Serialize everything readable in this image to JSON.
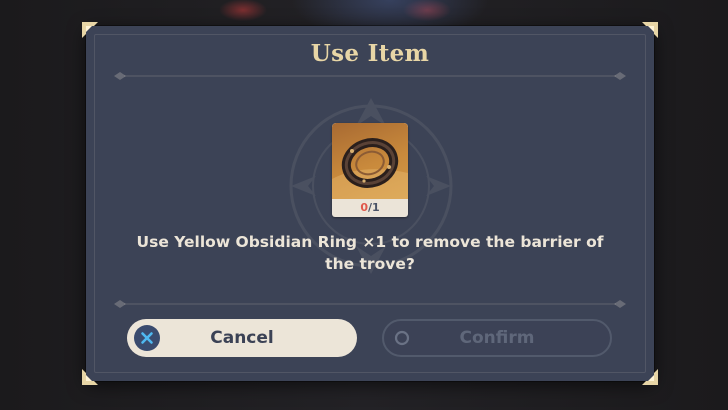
{
  "dialog": {
    "title": "Use Item",
    "item": {
      "name": "Yellow Obsidian Ring",
      "icon": "obsidian-ring-icon",
      "count_have": "0",
      "count_need": "/1"
    },
    "message": "Use Yellow Obsidian Ring ×1 to remove the barrier of the trove?",
    "buttons": {
      "cancel_label": "Cancel",
      "cancel_icon": "close-x-icon",
      "confirm_label": "Confirm",
      "confirm_icon": "circle-icon"
    }
  },
  "colors": {
    "panel": "#3c4356",
    "title": "#e8d6a6",
    "text": "#ece5d8",
    "count_insufficient": "#e0574a",
    "cancel_bg": "#ece5d8",
    "cancel_icon_bg": "#3a4b6e",
    "confirm_disabled": "#5f677a"
  }
}
